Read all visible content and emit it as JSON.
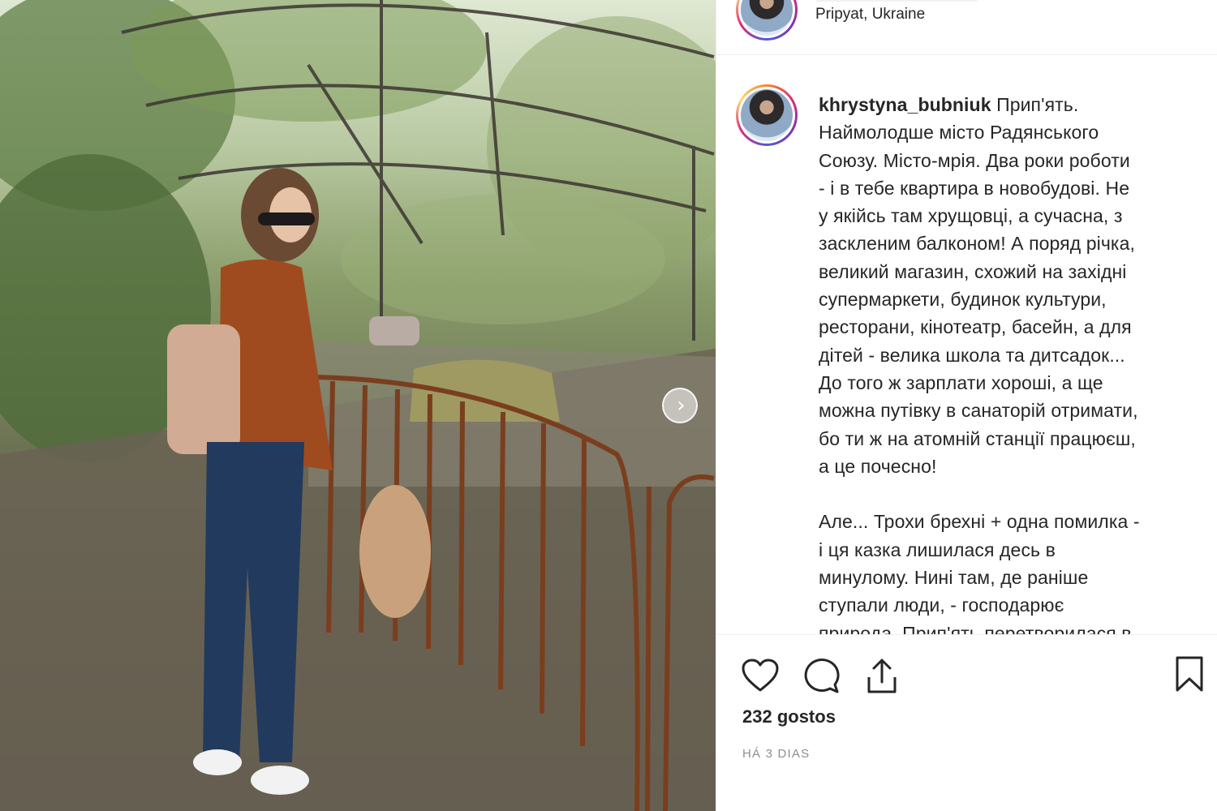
{
  "header": {
    "location": "Pripyat, Ukraine"
  },
  "caption": {
    "username": "khrystyna_bubniuk",
    "text": " Прип'ять.\nНаймолодше місто Радянського\nСоюзу. Місто-мрія. Два роки роботи\n- і в тебе квартира в новобудові. Не\nу якійсь там хрущовці, а сучасна, з\nзаскленим балконом! А поряд річка,\nвеликий магазин, схожий на західні\nсупермаркети, будинок культури,\nресторани, кінотеатр, басейн, а для\nдітей - велика школа та дитсадок...\nДо того ж зарплати хороші, а ще\nможна путівку в санаторій отримати,\nбо ти ж на атомній станції працюєш,\nа це почесно!\n\nАле... Трохи брехні + одна помилка -\nі ця казка лишилася десь в\nминулому. Нині там, де раніше\nступали люди, - господарює\nприрода. Прип'ять перетворилася в"
  },
  "actions": {
    "likes": "232 gostos",
    "time": "HÁ 3 DIAS"
  },
  "icons": {
    "like": "heart-icon",
    "comment": "comment-icon",
    "share": "share-icon",
    "save": "bookmark-icon",
    "next": "chevron-right-icon"
  },
  "colors": {
    "text": "#262626",
    "muted": "#8e8e8e",
    "divider": "#efefef"
  }
}
